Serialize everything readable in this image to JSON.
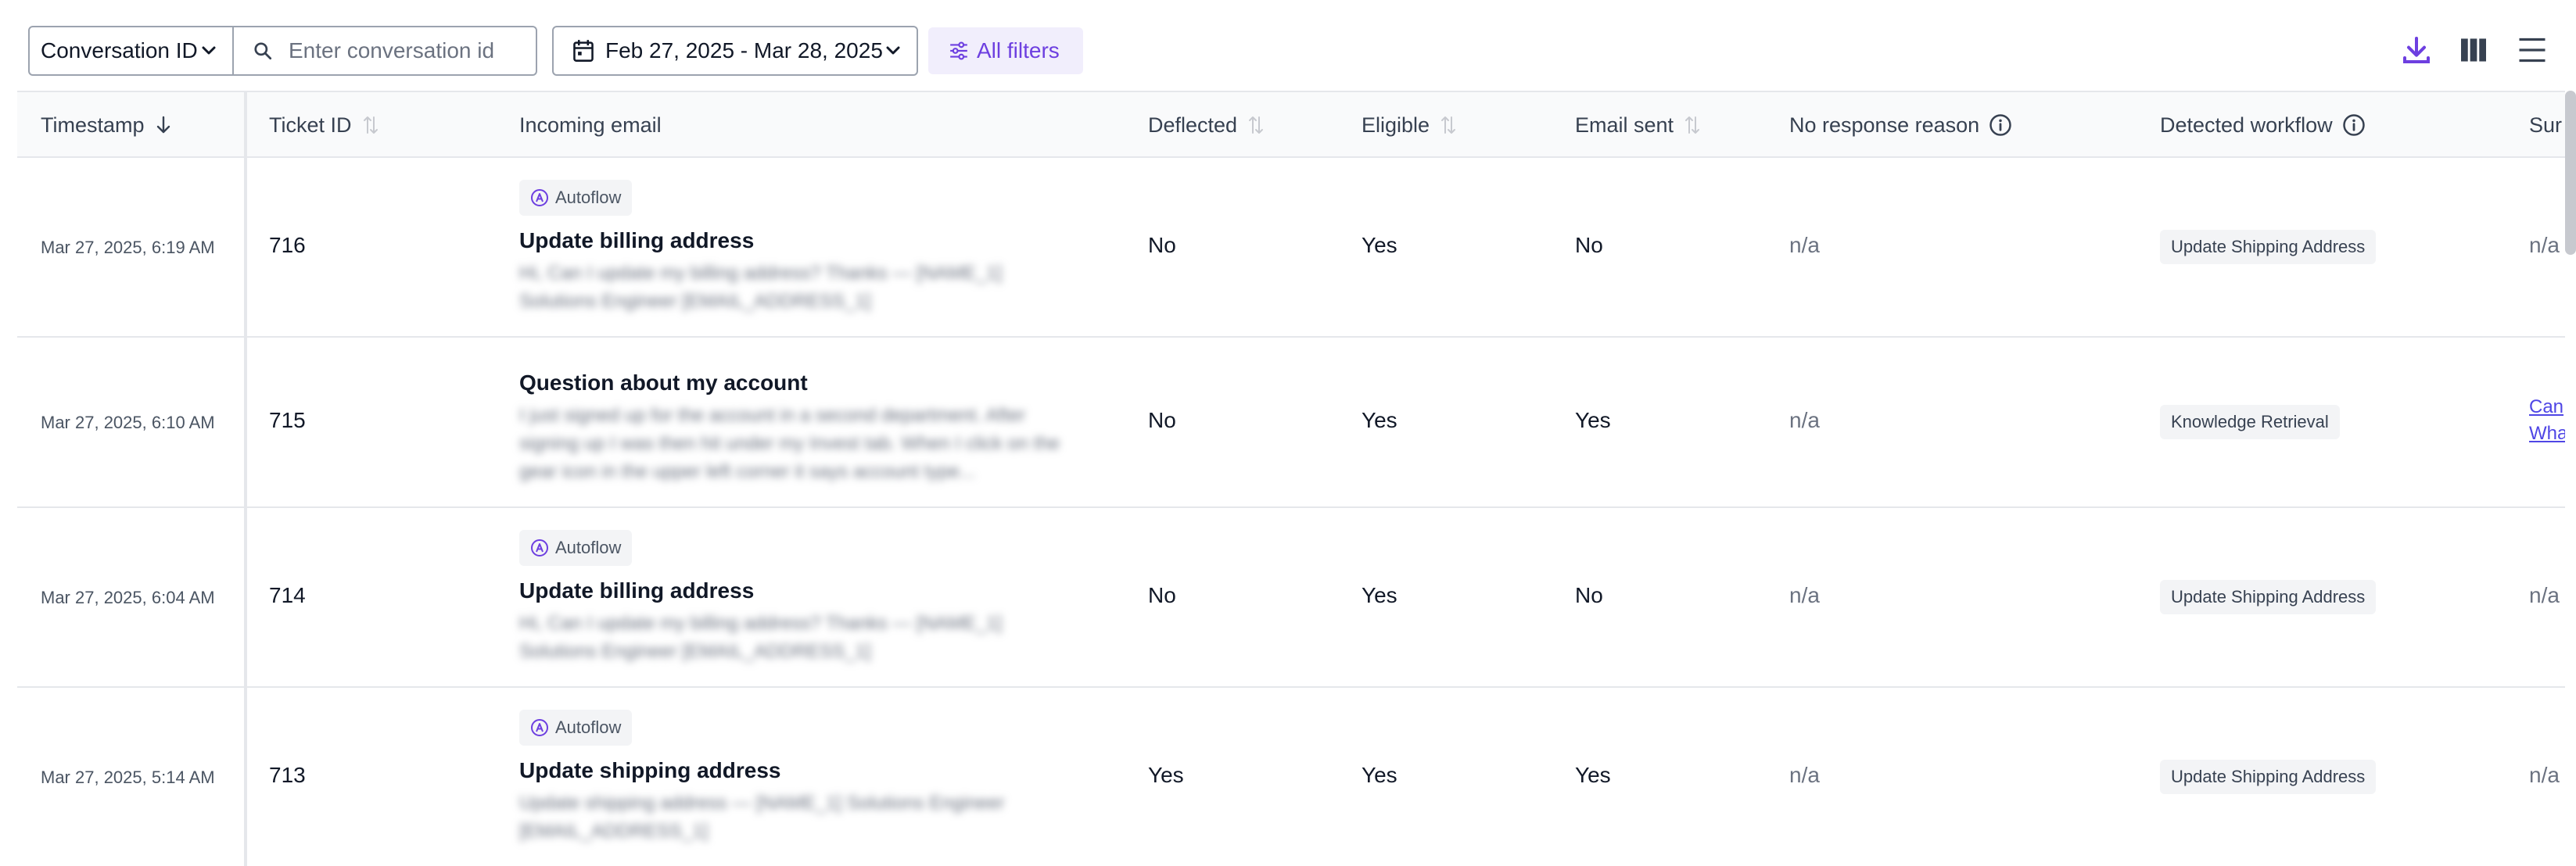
{
  "toolbar": {
    "filter_field": "Conversation ID",
    "search_placeholder": "Enter conversation id",
    "date_range": "Feb 27, 2025 - Mar 28, 2025",
    "all_filters": "All filters",
    "accent": "#6d3fe0"
  },
  "columns": {
    "timestamp": "Timestamp",
    "ticket_id": "Ticket ID",
    "incoming_email": "Incoming email",
    "deflected": "Deflected",
    "eligible": "Eligible",
    "email_sent": "Email sent",
    "no_response_reason": "No response reason",
    "detected_workflow": "Detected workflow",
    "summary_truncated": "Sur"
  },
  "rows": [
    {
      "timestamp": "Mar 27, 2025, 6:19 AM",
      "ticket_id": "716",
      "tag": "Autoflow",
      "subject": "Update billing address",
      "preview": "Hi, Can I update my billing address? Thanks — [NAME_1] Solutions Engineer [EMAIL_ADDRESS_1]",
      "deflected": "No",
      "eligible": "Yes",
      "email_sent": "No",
      "no_response_reason": "n/a",
      "workflow": "Update Shipping Address",
      "summary": "n/a"
    },
    {
      "timestamp": "Mar 27, 2025, 6:10 AM",
      "ticket_id": "715",
      "tag": "",
      "subject": "Question about my account",
      "preview": "I just signed up for the account in a second department. After signing up I was then hit under my Invest tab. When I click on the gear icon in the upper left corner it says account type...",
      "deflected": "No",
      "eligible": "Yes",
      "email_sent": "Yes",
      "no_response_reason": "n/a",
      "workflow": "Knowledge Retrieval",
      "summary_link_1": "Can",
      "summary_link_2": "Wha"
    },
    {
      "timestamp": "Mar 27, 2025, 6:04 AM",
      "ticket_id": "714",
      "tag": "Autoflow",
      "subject": "Update billing address",
      "preview": "Hi, Can I update my billing address? Thanks — [NAME_1] Solutions Engineer [EMAIL_ADDRESS_1]",
      "deflected": "No",
      "eligible": "Yes",
      "email_sent": "No",
      "no_response_reason": "n/a",
      "workflow": "Update Shipping Address",
      "summary": "n/a"
    },
    {
      "timestamp": "Mar 27, 2025, 5:14 AM",
      "ticket_id": "713",
      "tag": "Autoflow",
      "subject": "Update shipping address",
      "preview": "Update shipping address — [NAME_1] Solutions Engineer [EMAIL_ADDRESS_1]",
      "deflected": "Yes",
      "eligible": "Yes",
      "email_sent": "Yes",
      "no_response_reason": "n/a",
      "workflow": "Update Shipping Address",
      "summary": "n/a"
    }
  ]
}
